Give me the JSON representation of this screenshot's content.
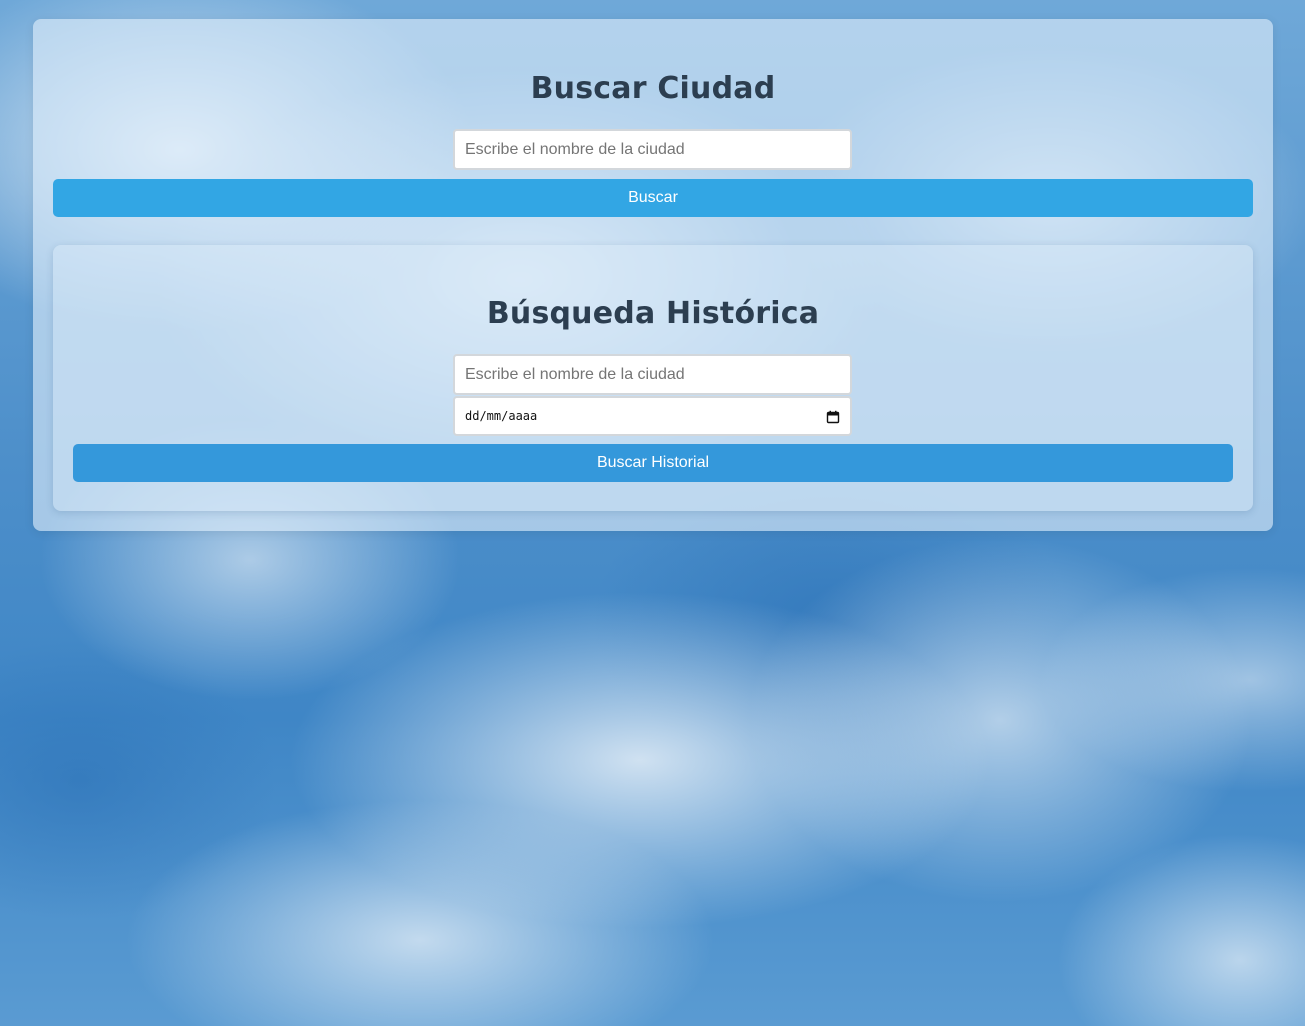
{
  "search": {
    "title": "Buscar Ciudad",
    "city_placeholder": "Escribe el nombre de la ciudad",
    "city_value": "",
    "button_label": "Buscar"
  },
  "history": {
    "title": "Búsqueda Histórica",
    "city_placeholder": "Escribe el nombre de la ciudad",
    "city_value": "",
    "date_placeholder": "dd/mm/aaaa",
    "button_label": "Buscar Historial"
  },
  "icons": {
    "date_picker": "calendar-icon"
  },
  "colors": {
    "search_button": "#32a6e4",
    "history_button": "#3498db",
    "title_text": "#2c3e50"
  }
}
